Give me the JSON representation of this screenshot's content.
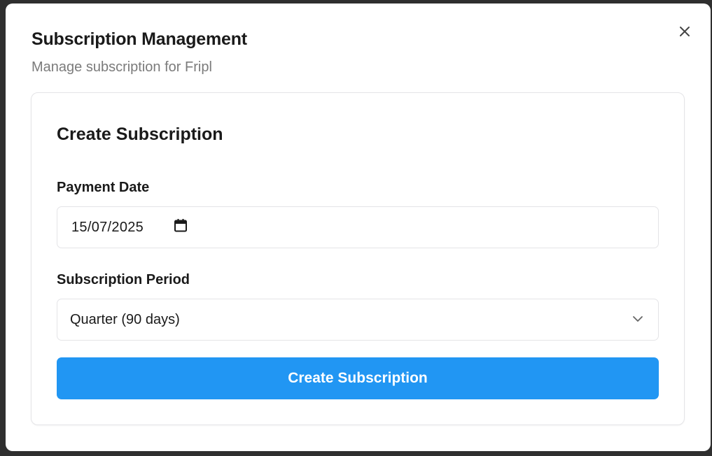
{
  "modal": {
    "title": "Subscription Management",
    "subtitle": "Manage subscription for Fripl"
  },
  "card": {
    "title": "Create Subscription",
    "payment_date": {
      "label": "Payment Date",
      "value": "15/07/2025",
      "icon": "calendar-icon"
    },
    "subscription_period": {
      "label": "Subscription Period",
      "selected": "Quarter (90 days)",
      "icon": "chevron-down-icon"
    },
    "submit_label": "Create Subscription"
  },
  "colors": {
    "primary": "#2196f3",
    "subtitle": "#7b7b7b",
    "border": "#e4e4e7"
  }
}
